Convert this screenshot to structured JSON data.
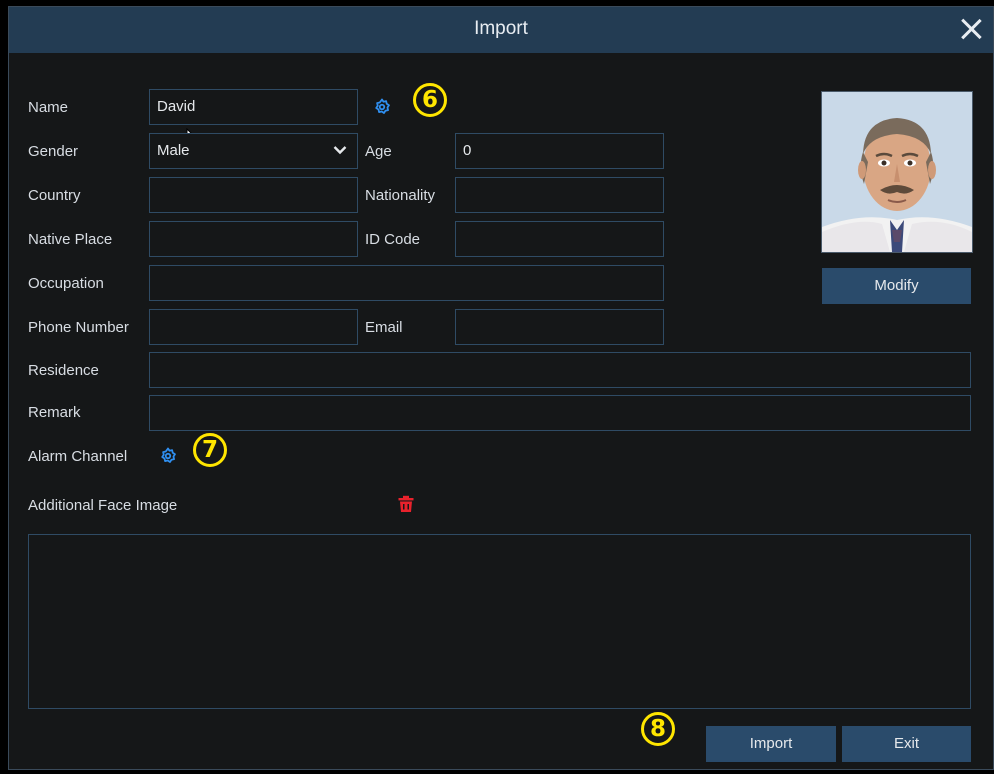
{
  "dialog": {
    "title": "Import"
  },
  "form": {
    "name": {
      "label": "Name",
      "value": "David"
    },
    "gender": {
      "label": "Gender",
      "value": "Male"
    },
    "age": {
      "label": "Age",
      "value": "0"
    },
    "country": {
      "label": "Country",
      "value": ""
    },
    "nationality": {
      "label": "Nationality",
      "value": ""
    },
    "native_place": {
      "label": "Native Place",
      "value": ""
    },
    "id_code": {
      "label": "ID Code",
      "value": ""
    },
    "occupation": {
      "label": "Occupation",
      "value": ""
    },
    "phone": {
      "label": "Phone Number",
      "value": ""
    },
    "email": {
      "label": "Email",
      "value": ""
    },
    "residence": {
      "label": "Residence",
      "value": ""
    },
    "remark": {
      "label": "Remark",
      "value": ""
    },
    "alarm_channel": {
      "label": "Alarm Channel"
    },
    "additional_face": {
      "label": "Additional Face Image"
    }
  },
  "photo": {
    "modify_label": "Modify"
  },
  "footer": {
    "import_label": "Import",
    "exit_label": "Exit"
  },
  "callouts": {
    "six": "6",
    "seven": "7",
    "eight": "8"
  },
  "colors": {
    "accent": "#2a4b6b",
    "titlebar": "#233c53",
    "gear": "#2f8ff0",
    "trash": "#e8222c",
    "callout": "#ffe600"
  },
  "icons": {
    "gear": "gear-icon",
    "trash": "trash-icon",
    "close": "close-icon",
    "dropdown": "chevron-down-icon"
  }
}
